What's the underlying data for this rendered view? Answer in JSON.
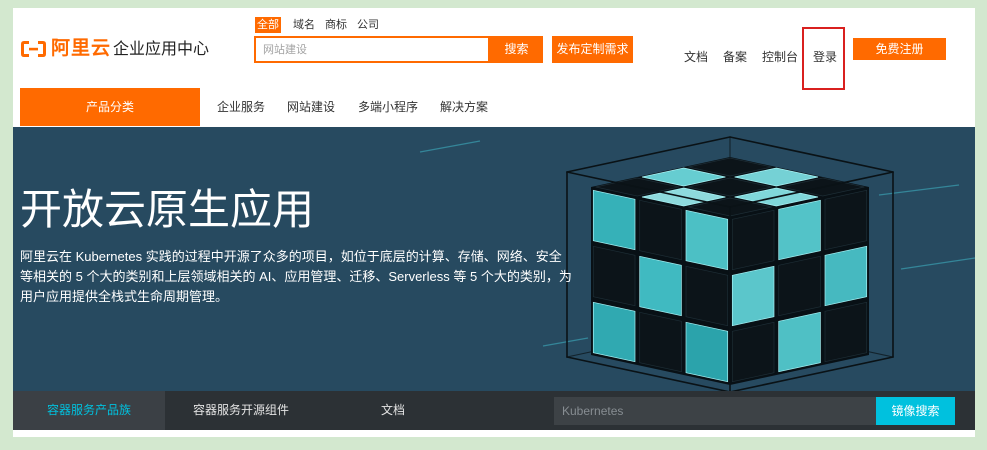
{
  "colors": {
    "brand_orange": "#ff6a00",
    "banner_bg": "#274a60",
    "subbar_bg": "#2c3135",
    "accent_teal": "#00c1de",
    "highlight_red": "#d9201f"
  },
  "header": {
    "logo": {
      "icon": "aliyun-logo-icon",
      "brand": "阿里云",
      "subtitle": "企业应用中心"
    },
    "search": {
      "tabs": [
        {
          "label": "全部",
          "active": true
        },
        {
          "label": "域名",
          "active": false
        },
        {
          "label": "商标",
          "active": false
        },
        {
          "label": "公司",
          "active": false
        }
      ],
      "placeholder": "网站建设",
      "button_label": "搜索"
    },
    "publish_button_label": "发布定制需求",
    "nav_links": [
      "文档",
      "备案",
      "控制台",
      "登录"
    ],
    "register_button_label": "免费注册"
  },
  "main_nav": {
    "category_label": "产品分类",
    "items": [
      "企业服务",
      "网站建设",
      "多端小程序",
      "解决方案"
    ]
  },
  "banner": {
    "title": "开放云原生应用",
    "description_lines": [
      "阿里云在 Kubernetes 实践的过程中开源了众多的项目，如位于底层的计算、存储、网络、安全",
      "等相关的 5 个大的类别和上层领域相关的 AI、应用管理、迁移、Serverless 等 5 个大的类别，为",
      "用户应用提供全栈式生命周期管理。"
    ]
  },
  "sub_bar": {
    "tabs": [
      {
        "label": "容器服务产品族",
        "active": true
      },
      {
        "label": "容器服务开源组件",
        "active": false
      },
      {
        "label": "文档",
        "active": false
      }
    ],
    "search_placeholder": "Kubernetes",
    "search_button_label": "镜像搜索"
  }
}
